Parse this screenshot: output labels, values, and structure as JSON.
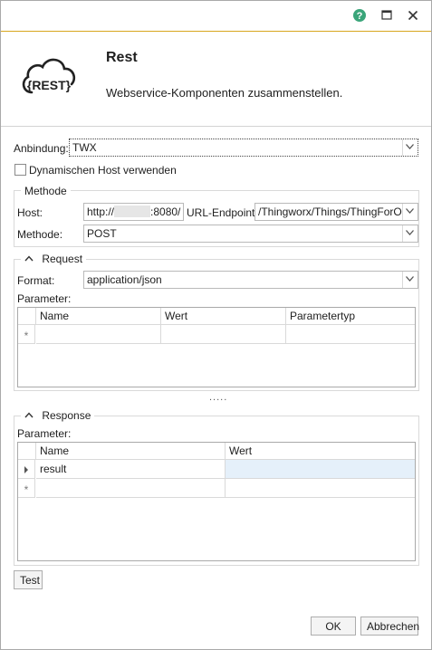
{
  "window": {
    "controls": {
      "help": "help-icon",
      "maximize": "maximize-icon",
      "close": "close-icon"
    },
    "accent_color": "#d8a61e"
  },
  "header": {
    "logo_text": "{REST}",
    "title": "Rest",
    "subtitle": "Webservice-Komponenten zusammenstellen."
  },
  "binding": {
    "label": "Anbindung:",
    "value": "TWX",
    "dynamic_host_label": "Dynamischen Host verwenden",
    "dynamic_host_checked": false
  },
  "method_group": {
    "title": "Methode",
    "host_label": "Host:",
    "host_value_prefix": "http://",
    "host_value_suffix": ":8080/",
    "endpoint_label": "URL-Endpoint:",
    "endpoint_value": "/Thingworx/Things/ThingForOPC",
    "method_label": "Methode:",
    "method_value": "POST"
  },
  "request": {
    "title": "Request",
    "format_label": "Format:",
    "format_value": "application/json",
    "params_label": "Parameter:",
    "columns": [
      "Name",
      "Wert",
      "Parametertyp"
    ],
    "new_row_marker": "*"
  },
  "splitter": ".....",
  "response": {
    "title": "Response",
    "params_label": "Parameter:",
    "columns": [
      "Name",
      "Wert"
    ],
    "rows": [
      {
        "name": "result",
        "value": ""
      }
    ],
    "new_row_marker": "*"
  },
  "buttons": {
    "test": "Test",
    "ok": "OK",
    "cancel": "Abbrechen"
  }
}
